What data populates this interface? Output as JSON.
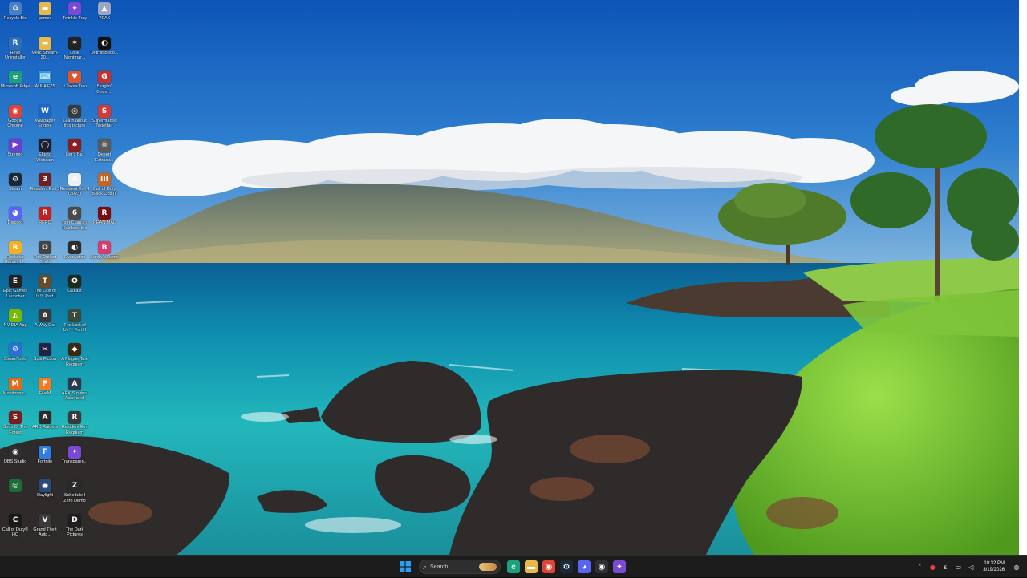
{
  "desktop": {
    "icons": [
      {
        "label": "Recycle Bin",
        "icon": "recycle-bin-icon",
        "color": "#4a7fc1",
        "glyph": "♻"
      },
      {
        "label": "games",
        "icon": "folder-icon",
        "color": "#e8b84a",
        "glyph": "▬"
      },
      {
        "label": "Twinkle Tray",
        "icon": "twinkle-tray-icon",
        "color": "#7a4ad6",
        "glyph": "✦"
      },
      {
        "label": "PEAK",
        "icon": "peak-icon",
        "color": "#9aa6c4",
        "glyph": "▲"
      },
      {
        "label": "Revo Uninstaller",
        "icon": "revo-uninstaller-icon",
        "color": "#2b6fb8",
        "glyph": "R"
      },
      {
        "label": "Merc Stream-20...",
        "icon": "folder-icon",
        "color": "#e8b84a",
        "glyph": "▬"
      },
      {
        "label": "Little Nightmar...",
        "icon": "little-nightmares-icon",
        "color": "#222222",
        "glyph": "✶"
      },
      {
        "label": "Detroit Beco...",
        "icon": "detroit-icon",
        "color": "#111111",
        "glyph": "◐"
      },
      {
        "label": "Microsoft Edge",
        "icon": "edge-icon",
        "color": "#1aa07a",
        "glyph": "e"
      },
      {
        "label": "AULA F75",
        "icon": "aula-icon",
        "color": "#2f9ae0",
        "glyph": "⌨"
      },
      {
        "label": "It Takes Two",
        "icon": "it-takes-two-icon",
        "color": "#e0542e",
        "glyph": "♥"
      },
      {
        "label": "Burglin' Gnom...",
        "icon": "burglin-gnomes-icon",
        "color": "#c9302c",
        "glyph": "G"
      },
      {
        "label": "Google Chrome",
        "icon": "chrome-icon",
        "color": "#db4437",
        "glyph": "◉"
      },
      {
        "label": "Wallpaper Engine",
        "icon": "wallpaper-engine-icon",
        "color": "#1d65c9",
        "glyph": "W"
      },
      {
        "label": "Learn about this picture",
        "icon": "learn-picture-icon",
        "color": "#3a3a3a",
        "glyph": "◎"
      },
      {
        "label": "Supermarket Together",
        "icon": "supermarket-together-icon",
        "color": "#d13a3a",
        "glyph": "S"
      },
      {
        "label": "Stremio",
        "icon": "stremio-icon",
        "color": "#6b3fcf",
        "glyph": "▶"
      },
      {
        "label": "Elgato Webcam",
        "icon": "elgato-webcam-icon",
        "color": "#1e1e2e",
        "glyph": "◯"
      },
      {
        "label": "Liar's Bar",
        "icon": "liars-bar-icon",
        "color": "#8a1d1d",
        "glyph": "♠"
      },
      {
        "label": "Desert Extracti...",
        "icon": "desert-extraction-icon",
        "color": "#5a5a5a",
        "glyph": "☠"
      },
      {
        "label": "Steam",
        "icon": "steam-icon",
        "color": "#1b2838",
        "glyph": "⚙"
      },
      {
        "label": "Resident Evil 3",
        "icon": "resident-evil-3-icon",
        "color": "#6e1f1f",
        "glyph": "3"
      },
      {
        "label": "Resident Evil 4 (2023)",
        "icon": "resident-evil-4-icon",
        "color": "#eeeeee",
        "glyph": "A"
      },
      {
        "label": "Call of Duty Black Ops III",
        "icon": "cod-bo3-icon",
        "color": "#c8651f",
        "glyph": "III"
      },
      {
        "label": "Discord",
        "icon": "discord-icon",
        "color": "#5865f2",
        "glyph": "◕"
      },
      {
        "label": "REPO",
        "icon": "repo-icon",
        "color": "#c81e1e",
        "glyph": "R"
      },
      {
        "label": "Tom Clancy's Rainbow Six",
        "icon": "rainbow-six-icon",
        "color": "#4a4a4a",
        "glyph": "6"
      },
      {
        "label": "REANIMAL",
        "icon": "reanimal-icon",
        "color": "#7a0d0d",
        "glyph": "R"
      },
      {
        "label": "Rockstar Games L...",
        "icon": "rockstar-icon",
        "color": "#f2b01e",
        "glyph": "R"
      },
      {
        "label": "The Outlast Trials",
        "icon": "outlast-trials-icon",
        "color": "#444444",
        "glyph": "O"
      },
      {
        "label": "Overwatch",
        "icon": "overwatch-icon",
        "color": "#2d2d2d",
        "glyph": "◐"
      },
      {
        "label": "Bendy's Demo",
        "icon": "bendy-demo-icon",
        "color": "#d93b6f",
        "glyph": "B"
      },
      {
        "label": "Epic Games Launcher",
        "icon": "epic-games-icon",
        "color": "#222222",
        "glyph": "E"
      },
      {
        "label": "The Last of Us™ Part I",
        "icon": "last-of-us-1-icon",
        "color": "#6b4a2a",
        "glyph": "T"
      },
      {
        "label": "Outlast",
        "icon": "outlast-icon",
        "color": "#1f2a1f",
        "glyph": "O"
      },
      null,
      {
        "label": "NVIDIA App",
        "icon": "nvidia-icon",
        "color": "#76b900",
        "glyph": "◭"
      },
      {
        "label": "A Way Out",
        "icon": "a-way-out-icon",
        "color": "#3a3a3a",
        "glyph": "A"
      },
      {
        "label": "The Last of Us™ Part II",
        "icon": "last-of-us-2-icon",
        "color": "#3b4a3b",
        "glyph": "T"
      },
      null,
      {
        "label": "SteamTools",
        "icon": "steamtools-icon",
        "color": "#2a6fd1",
        "glyph": "⚙"
      },
      {
        "label": "Split Fiction",
        "icon": "split-fiction-icon",
        "color": "#222244",
        "glyph": "✂"
      },
      {
        "label": "A Plague Tale Requiem",
        "icon": "plague-tale-icon",
        "color": "#3b2a10",
        "glyph": "◆"
      },
      null,
      {
        "label": "Monitoring...",
        "icon": "monitoring-icon",
        "color": "#e26a1a",
        "glyph": "M"
      },
      {
        "label": "FiveM",
        "icon": "fivem-icon",
        "color": "#f57b1f",
        "glyph": "F"
      },
      {
        "label": "ARK Survival Ascended",
        "icon": "ark-icon",
        "color": "#2a3a4a",
        "glyph": "A"
      },
      null,
      {
        "label": "Sons Of The Forest",
        "icon": "sons-forest-icon",
        "color": "#7a1d1d",
        "glyph": "S"
      },
      {
        "label": "ARC Raiders",
        "icon": "arc-raiders-icon",
        "color": "#2b2b2b",
        "glyph": "A"
      },
      {
        "label": "Resident Evil Requiem",
        "icon": "resident-evil-requiem-icon",
        "color": "#3a3a3a",
        "glyph": "R"
      },
      null,
      {
        "label": "OBS Studio",
        "icon": "obs-icon",
        "color": "#302e31",
        "glyph": "◉"
      },
      {
        "label": "Fortnite",
        "icon": "fortnite-icon",
        "color": "#2f7de1",
        "glyph": "F"
      },
      {
        "label": "Transparen...",
        "icon": "transparent-icon",
        "color": "#7a4ad6",
        "glyph": "✦"
      },
      null,
      {
        "label": "",
        "icon": "unknown-app-icon",
        "color": "#1f6b3a",
        "glyph": "◎"
      },
      {
        "label": "Daylight",
        "icon": "daylight-icon",
        "color": "#2a4a7a",
        "glyph": "◉"
      },
      {
        "label": "Schedule I Zero Demo",
        "icon": "schedule-zero-icon",
        "color": "#2a2a2a",
        "glyph": "Z"
      },
      null,
      {
        "label": "Call of Duty® HQ",
        "icon": "cod-hq-icon",
        "color": "#1a1a1a",
        "glyph": "C"
      },
      {
        "label": "Grand Theft Auto...",
        "icon": "gta-icon",
        "color": "#3a3a3a",
        "glyph": "V"
      },
      {
        "label": "The Dark Pictures",
        "icon": "dark-pictures-icon",
        "color": "#1f1f1f",
        "glyph": "D"
      },
      null
    ]
  },
  "taskbar": {
    "search_placeholder": "Search",
    "apps": [
      {
        "name": "taskbar-edge-icon",
        "glyph": "e",
        "color": "#1aa07a"
      },
      {
        "name": "taskbar-file-explorer-icon",
        "glyph": "▬",
        "color": "#e8b84a"
      },
      {
        "name": "taskbar-chrome-icon",
        "glyph": "◉",
        "color": "#db4437"
      },
      {
        "name": "taskbar-steam-icon",
        "glyph": "⚙",
        "color": "#1b2838"
      },
      {
        "name": "taskbar-discord-icon",
        "glyph": "◕",
        "color": "#5865f2"
      },
      {
        "name": "taskbar-obs-icon",
        "glyph": "◉",
        "color": "#302e31"
      },
      {
        "name": "taskbar-twinkle-tray-icon",
        "glyph": "✦",
        "color": "#7a4ad6"
      }
    ],
    "tray": {
      "time": "10:32 PM",
      "date": "3/19/2026"
    }
  }
}
